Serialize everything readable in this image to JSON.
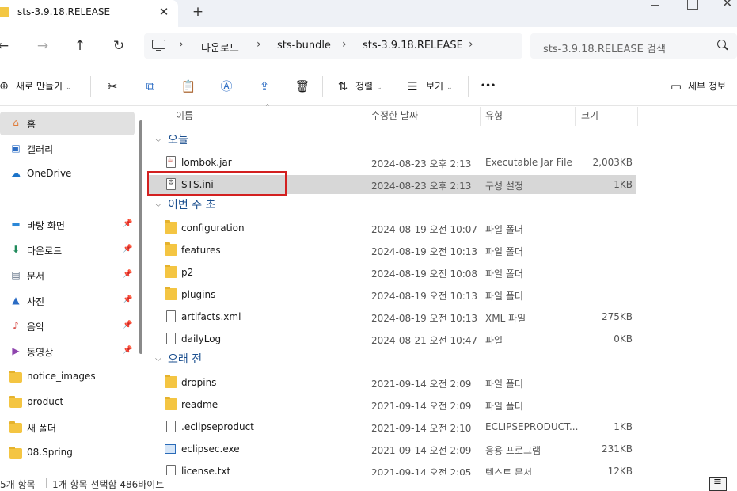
{
  "window": {
    "tab_title": "sts-3.9.18.RELEASE",
    "tab_close": "✕",
    "new_tab": "+"
  },
  "nav": {
    "back": "←",
    "forward": "→",
    "up": "↑",
    "refresh": "↻",
    "breadcrumb": [
      "다운로드",
      "sts-bundle",
      "sts-3.9.18.RELEASE"
    ],
    "separator": "›",
    "search_placeholder": "sts-3.9.18.RELEASE 검색"
  },
  "toolbar": {
    "new_label": "새로 만들기",
    "sort_label": "정렬",
    "view_label": "보기",
    "more": "•••",
    "details_label": "세부 정보"
  },
  "sidebar": {
    "items": [
      {
        "label": "홈",
        "icon": "home-icon"
      },
      {
        "label": "갤러리",
        "icon": "gallery-icon"
      },
      {
        "label": "OneDrive",
        "icon": "onedrive-icon"
      },
      {
        "label": "바탕 화면",
        "icon": "desktop-icon",
        "pinned": true
      },
      {
        "label": "다운로드",
        "icon": "download-icon",
        "pinned": true
      },
      {
        "label": "문서",
        "icon": "documents-icon",
        "pinned": true
      },
      {
        "label": "사진",
        "icon": "pictures-icon",
        "pinned": true
      },
      {
        "label": "음악",
        "icon": "music-icon",
        "pinned": true
      },
      {
        "label": "동영상",
        "icon": "videos-icon",
        "pinned": true
      },
      {
        "label": "notice_images",
        "icon": "folder-icon"
      },
      {
        "label": "product",
        "icon": "folder-icon"
      },
      {
        "label": "새 폴더",
        "icon": "folder-icon"
      },
      {
        "label": "08.Spring",
        "icon": "folder-icon"
      }
    ]
  },
  "columns": {
    "name": "이름",
    "modified": "수정한 날짜",
    "type": "유형",
    "size": "크기"
  },
  "groups": {
    "today": "오늘",
    "this_week": "이번 주 초",
    "long_ago": "오래 전"
  },
  "files": [
    {
      "name": "lombok.jar",
      "date": "2024-08-23 오후 2:13",
      "type": "Executable Jar File",
      "size": "2,003KB",
      "kind": "jar"
    },
    {
      "name": "STS.ini",
      "date": "2024-08-23 오후 2:13",
      "type": "구성 설정",
      "size": "1KB",
      "kind": "ini",
      "selected": true
    },
    {
      "name": "configuration",
      "date": "2024-08-19 오전 10:07",
      "type": "파일 폴더",
      "size": "",
      "kind": "folder"
    },
    {
      "name": "features",
      "date": "2024-08-19 오전 10:13",
      "type": "파일 폴더",
      "size": "",
      "kind": "folder"
    },
    {
      "name": "p2",
      "date": "2024-08-19 오전 10:08",
      "type": "파일 폴더",
      "size": "",
      "kind": "folder"
    },
    {
      "name": "plugins",
      "date": "2024-08-19 오전 10:13",
      "type": "파일 폴더",
      "size": "",
      "kind": "folder"
    },
    {
      "name": "artifacts.xml",
      "date": "2024-08-19 오전 10:13",
      "type": "XML 파일",
      "size": "275KB",
      "kind": "file"
    },
    {
      "name": "dailyLog",
      "date": "2024-08-21 오전 10:47",
      "type": "파일",
      "size": "0KB",
      "kind": "file"
    },
    {
      "name": "dropins",
      "date": "2021-09-14 오전 2:09",
      "type": "파일 폴더",
      "size": "",
      "kind": "folder"
    },
    {
      "name": "readme",
      "date": "2021-09-14 오전 2:09",
      "type": "파일 폴더",
      "size": "",
      "kind": "folder"
    },
    {
      "name": ".eclipseproduct",
      "date": "2021-09-14 오전 2:10",
      "type": "ECLIPSEPRODUCT...",
      "size": "1KB",
      "kind": "file"
    },
    {
      "name": "eclipsec.exe",
      "date": "2021-09-14 오전 2:09",
      "type": "응용 프로그램",
      "size": "231KB",
      "kind": "exe"
    },
    {
      "name": "license.txt",
      "date": "2021-09-14 오전 2:05",
      "type": "텍스트 문서",
      "size": "12KB",
      "kind": "file"
    }
  ],
  "status": {
    "item_count": "5개 항목",
    "selection": "1개 항목 선택함 486바이트"
  },
  "colors": {
    "selection": "#d7d7d7",
    "highlight_box": "#d32020",
    "group_text": "#1b4f8f",
    "folder": "#f4c542"
  }
}
